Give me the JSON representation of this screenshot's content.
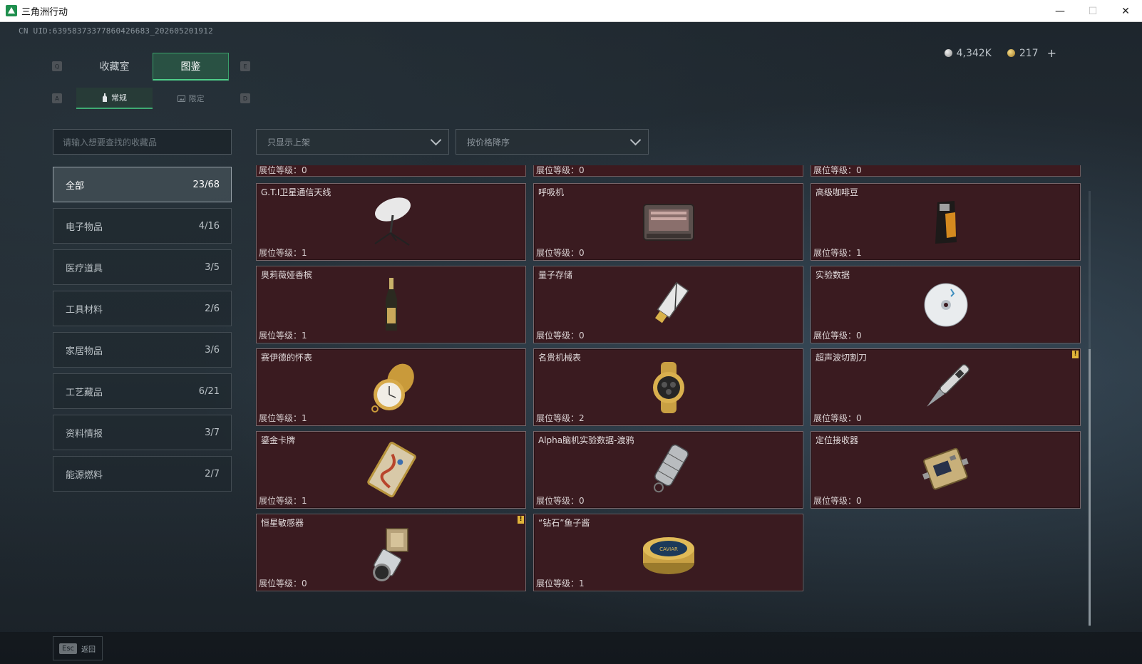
{
  "window": {
    "title": "三角洲行动",
    "minimize": "—",
    "maximize": "☐",
    "close": "✕"
  },
  "uid": "CN UID:6395837337786042668З_202605201912",
  "currency": {
    "silver": "4,342K",
    "gold": "217",
    "plus": "+"
  },
  "keys": {
    "q": "Q",
    "e": "E",
    "a": "A",
    "d": "D"
  },
  "tabs": {
    "main": [
      {
        "label": "收藏室"
      },
      {
        "label": "图鉴"
      }
    ],
    "sub": [
      {
        "label": "常规"
      },
      {
        "label": "限定"
      }
    ]
  },
  "search": {
    "placeholder": "请输入想要查找的收藏品"
  },
  "filters": {
    "shelf": "只显示上架",
    "sort": "按价格降序"
  },
  "categories": [
    {
      "label": "全部",
      "count": "23/68"
    },
    {
      "label": "电子物品",
      "count": "4/16"
    },
    {
      "label": "医疗道具",
      "count": "3/5"
    },
    {
      "label": "工具材料",
      "count": "2/6"
    },
    {
      "label": "家居物品",
      "count": "3/6"
    },
    {
      "label": "工艺藏品",
      "count": "6/21"
    },
    {
      "label": "资料情报",
      "count": "3/7"
    },
    {
      "label": "能源燃料",
      "count": "2/7"
    }
  ],
  "partial_row": [
    {
      "level": "展位等级：0"
    },
    {
      "level": "展位等级：0"
    },
    {
      "level": "展位等级：0"
    }
  ],
  "items": [
    {
      "name": "G.T.I卫星通信天线",
      "level": "展位等级：1",
      "icon": "satellite-dish-icon"
    },
    {
      "name": "呼吸机",
      "level": "展位等级：0",
      "icon": "ventilator-icon"
    },
    {
      "name": "高级咖啡豆",
      "level": "展位等级：1",
      "icon": "coffee-bag-icon"
    },
    {
      "name": "奥莉薇娅香槟",
      "level": "展位等级：1",
      "icon": "champagne-bottle-icon"
    },
    {
      "name": "量子存储",
      "level": "展位等级：0",
      "icon": "usb-drive-icon"
    },
    {
      "name": "实验数据",
      "level": "展位等级：0",
      "icon": "disc-icon"
    },
    {
      "name": "赛伊德的怀表",
      "level": "展位等级：1",
      "icon": "pocket-watch-icon"
    },
    {
      "name": "名贵机械表",
      "level": "展位等级：2",
      "icon": "wristwatch-icon"
    },
    {
      "name": "超声波切割刀",
      "level": "展位等级：0",
      "icon": "ultrasonic-knife-icon",
      "alert": "!"
    },
    {
      "name": "鎏金卡牌",
      "level": "展位等级：1",
      "icon": "gilded-card-icon"
    },
    {
      "name": "Alpha脑机实验数据-渡鸦",
      "level": "展位等级：0",
      "icon": "data-canister-icon"
    },
    {
      "name": "定位接收器",
      "level": "展位等级：0",
      "icon": "receiver-device-icon"
    },
    {
      "name": "恒星敏感器",
      "level": "展位等级：0",
      "icon": "star-sensor-icon",
      "alert": "!"
    },
    {
      "name": "“钻石”鱼子酱",
      "level": "展位等级：1",
      "icon": "caviar-tin-icon",
      "tin_label": "CAVIAR"
    }
  ],
  "footer": {
    "key": "Esc",
    "label": "返回"
  }
}
